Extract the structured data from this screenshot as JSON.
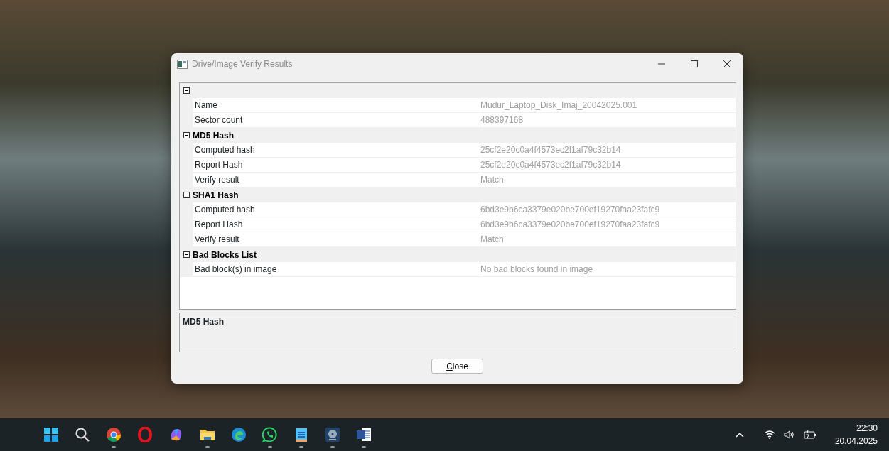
{
  "window": {
    "title": "Drive/Image Verify Results"
  },
  "property_grid": {
    "sections": [
      {
        "expanded": true,
        "rows": [
          {
            "label": "Name",
            "value": "Mudur_Laptop_Disk_Imaj_20042025.001"
          },
          {
            "label": "Sector count",
            "value": "488397168"
          }
        ]
      },
      {
        "title": "MD5 Hash",
        "expanded": true,
        "rows": [
          {
            "label": "Computed hash",
            "value": "25cf2e20c0a4f4573ec2f1af79c32b14"
          },
          {
            "label": "Report Hash",
            "value": "25cf2e20c0a4f4573ec2f1af79c32b14"
          },
          {
            "label": "Verify result",
            "value": "Match"
          }
        ]
      },
      {
        "title": "SHA1 Hash",
        "expanded": true,
        "rows": [
          {
            "label": "Computed hash",
            "value": "6bd3e9b6ca3379e020be700ef19270faa23fafc9"
          },
          {
            "label": "Report Hash",
            "value": "6bd3e9b6ca3379e020be700ef19270faa23fafc9"
          },
          {
            "label": "Verify result",
            "value": "Match"
          }
        ]
      },
      {
        "title": "Bad Blocks List",
        "expanded": true,
        "rows": [
          {
            "label": "Bad block(s) in image",
            "value": "No bad blocks found in image"
          }
        ]
      }
    ]
  },
  "description": {
    "title": "MD5 Hash"
  },
  "buttons": [
    {
      "label": "Close",
      "mnemonic": true
    }
  ],
  "taskbar": {
    "apps": [
      {
        "kind": "start",
        "running": false
      },
      {
        "kind": "search",
        "running": false
      },
      {
        "kind": "chrome",
        "running": true
      },
      {
        "kind": "opera",
        "running": false
      },
      {
        "kind": "copilot",
        "running": false
      },
      {
        "kind": "folder",
        "running": true
      },
      {
        "kind": "edge",
        "running": false
      },
      {
        "kind": "whatsapp",
        "running": true
      },
      {
        "kind": "notepad",
        "running": true
      },
      {
        "kind": "disk",
        "running": true
      },
      {
        "kind": "word",
        "running": true
      }
    ],
    "time": "22:30",
    "date": "20.04.2025"
  }
}
